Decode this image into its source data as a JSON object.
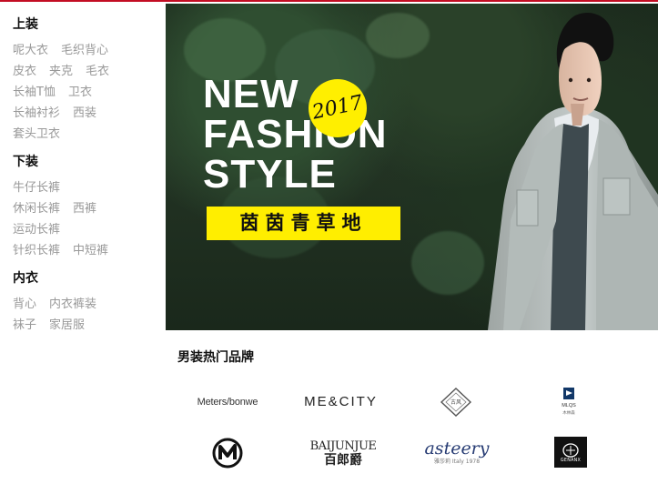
{
  "sidebar": {
    "sections": [
      {
        "title": "上装",
        "rows": [
          [
            "呢大衣",
            "毛织背心"
          ],
          [
            "皮衣",
            "夹克",
            "毛衣"
          ],
          [
            "长袖T恤",
            "卫衣"
          ],
          [
            "长袖衬衫",
            "西装"
          ],
          [
            "套头卫衣"
          ]
        ]
      },
      {
        "title": "下装",
        "rows": [
          [
            "牛仔长裤"
          ],
          [
            "休闲长裤",
            "西裤"
          ],
          [
            "运动长裤"
          ],
          [
            "针织长裤",
            "中短裤"
          ]
        ]
      },
      {
        "title": "内衣",
        "rows": [
          [
            "背心",
            "内衣裤装"
          ],
          [
            "袜子",
            "家居服"
          ]
        ]
      }
    ]
  },
  "banner": {
    "headline": [
      "NEW",
      "FASHION",
      "STYLE"
    ],
    "year": "2017",
    "slogan": "茵茵青草地"
  },
  "brands": {
    "title": "男装热门品牌",
    "row1": [
      "Meters/bonwe",
      "ME&CITY",
      "",
      ""
    ],
    "row2": [
      "",
      "BAIJUNJUE",
      "asteery",
      ""
    ],
    "baijunjue_cn": "百郎爵",
    "asteery_sub": "雅莎莉 Italy 1978",
    "mlqs": "MLQS",
    "dark_brand": "GENANX"
  },
  "colors": {
    "accent": "#c30d23",
    "yellow": "#ffee00"
  }
}
